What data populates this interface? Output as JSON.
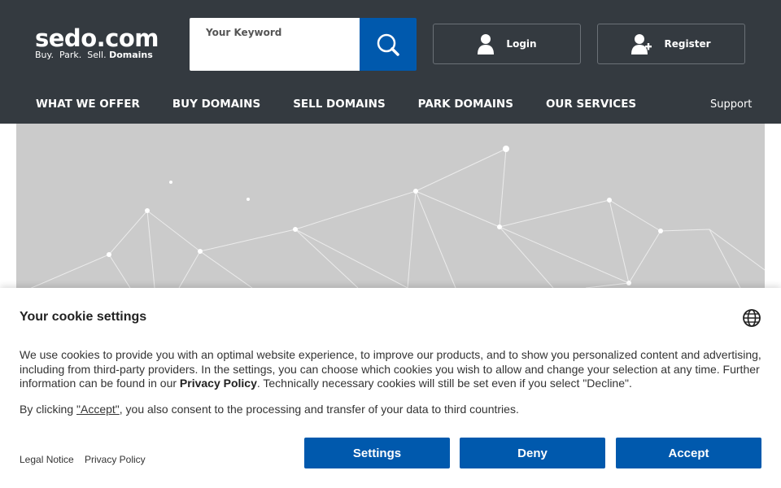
{
  "logo": {
    "name": "sedo.com",
    "tagline_plain": "Buy.  Park.  Sell.",
    "tagline_bold": "Domains"
  },
  "search": {
    "placeholder": "Your Keyword"
  },
  "header_buttons": {
    "login": "Login",
    "register": "Register"
  },
  "nav": {
    "items": [
      "WHAT WE OFFER",
      "BUY DOMAINS",
      "SELL DOMAINS",
      "PARK DOMAINS",
      "OUR SERVICES"
    ],
    "support": "Support"
  },
  "cookie": {
    "title": "Your cookie settings",
    "text_part1": "We use cookies to provide you with an optimal website experience, to improve our products, and to show you personalized content and advertising, including from third-party providers. In the settings, you can choose which cookies you wish to allow and change your selection at any time. Further information can be found in our ",
    "privacy_link": "Privacy Policy",
    "text_part2": ". Technically necessary cookies will still be set even if you select \"Decline\".",
    "consent_before": "By clicking ",
    "consent_accept": "\"Accept\"",
    "consent_after": ", you also consent to the processing and transfer of your data to third countries.",
    "legal_notice": "Legal Notice",
    "privacy_policy": "Privacy Policy",
    "settings_btn": "Settings",
    "deny_btn": "Deny",
    "accept_btn": "Accept"
  },
  "colors": {
    "header": "#343a40",
    "primary": "#0059ad",
    "hero": "#cbcbcb"
  },
  "icons": {
    "search": "search-icon",
    "user": "user-icon",
    "user_add": "user-add-icon",
    "globe": "globe-icon"
  }
}
